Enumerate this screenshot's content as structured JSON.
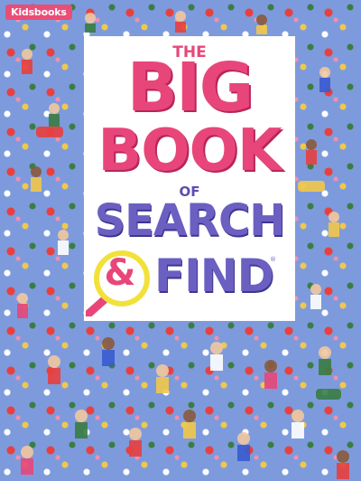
{
  "publisher": "Kidsbooks",
  "title": {
    "line1": "THE",
    "line2": "BIG",
    "line3": "BOOK",
    "line4": "OF",
    "line5": "SEARCH",
    "amp": "&",
    "line6": "FIND",
    "reg": "®"
  },
  "colors": {
    "title_pink": "#e8467a",
    "title_purple": "#6b5fc2",
    "magnifier_rim": "#f2e13a",
    "background_blue": "#7d9bdc"
  },
  "icons": [
    "magnifying-glass-icon"
  ]
}
